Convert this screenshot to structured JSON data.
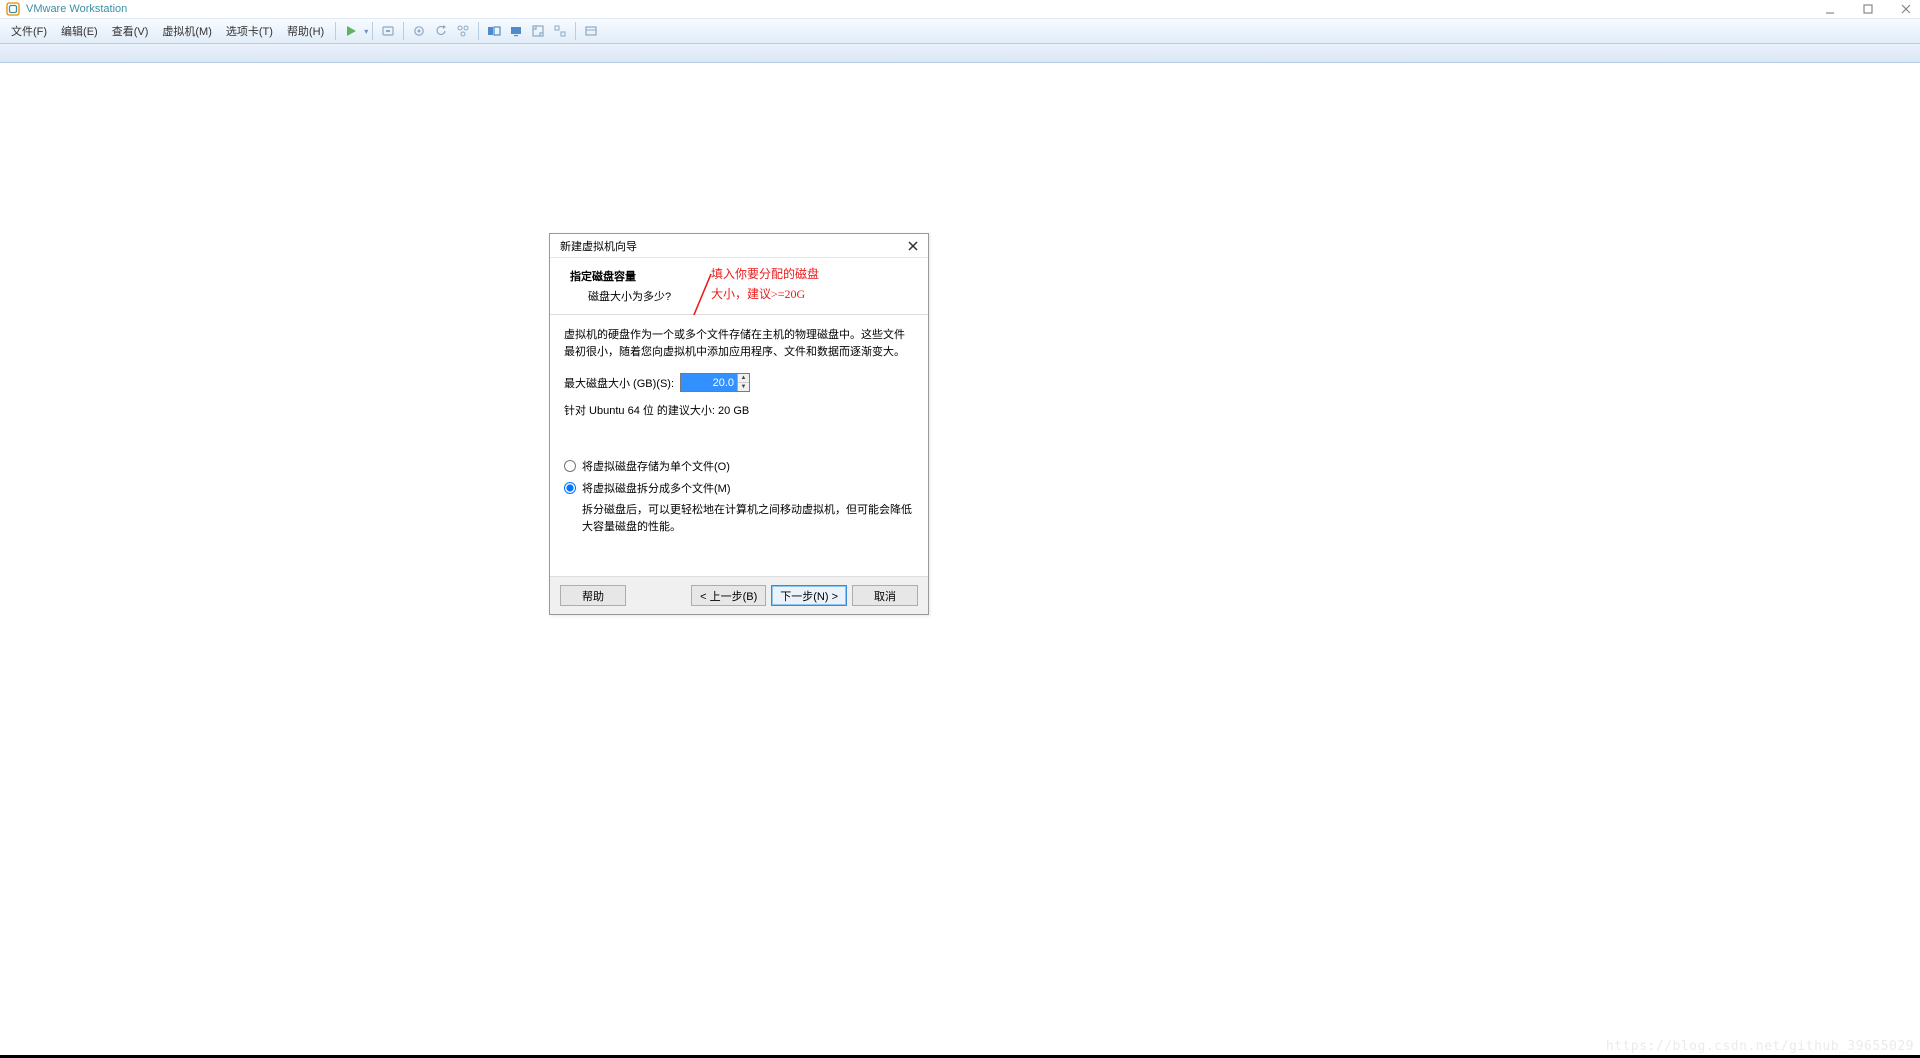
{
  "window": {
    "title": "VMware Workstation",
    "controls": {
      "min": "minimize",
      "max": "maximize",
      "close": "close"
    }
  },
  "menu": {
    "items": [
      "文件(F)",
      "编辑(E)",
      "查看(V)",
      "虚拟机(M)",
      "选项卡(T)",
      "帮助(H)"
    ]
  },
  "dialog": {
    "title": "新建虚拟机向导",
    "header_title": "指定磁盘容量",
    "header_sub": "磁盘大小为多少?",
    "desc": "虚拟机的硬盘作为一个或多个文件存储在主机的物理磁盘中。这些文件最初很小，随着您向虚拟机中添加应用程序、文件和数据而逐渐变大。",
    "size_label": "最大磁盘大小 (GB)(S):",
    "size_value": "20.0",
    "recommend": "针对 Ubuntu 64 位 的建议大小: 20 GB",
    "radio1": "将虚拟磁盘存储为单个文件(O)",
    "radio2": "将虚拟磁盘拆分成多个文件(M)",
    "radio2_help": "拆分磁盘后，可以更轻松地在计算机之间移动虚拟机，但可能会降低大容量磁盘的性能。",
    "btn_help": "帮助",
    "btn_back": "< 上一步(B)",
    "btn_next": "下一步(N) >",
    "btn_cancel": "取消"
  },
  "annotation": {
    "line1": "填入你要分配的磁盘",
    "line2": "大小，建议>=20G"
  },
  "watermark": "https://blog.csdn.net/github_39655029"
}
